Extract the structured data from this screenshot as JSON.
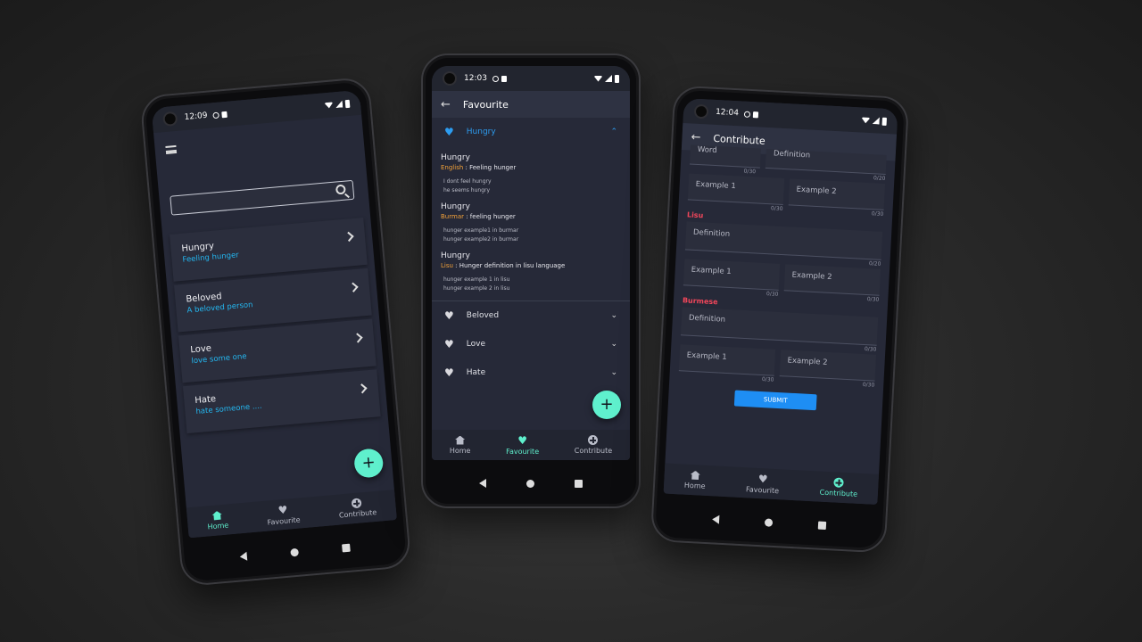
{
  "phone1": {
    "status_time": "12:09",
    "search": {
      "placeholder": ""
    },
    "words": [
      {
        "title": "Hungry",
        "subtitle": "Feeling hunger"
      },
      {
        "title": "Beloved",
        "subtitle": "A beloved person"
      },
      {
        "title": "Love",
        "subtitle": "love some one"
      },
      {
        "title": "Hate",
        "subtitle": "hate someone ...."
      }
    ],
    "fab_label": "+",
    "bottom_nav": [
      {
        "label": "Home",
        "icon": "home-icon",
        "active": true
      },
      {
        "label": "Favourite",
        "icon": "heart-icon",
        "active": false
      },
      {
        "label": "Contribute",
        "icon": "plus-circle-icon",
        "active": false
      }
    ]
  },
  "phone2": {
    "status_time": "12:03",
    "title": "Favourite",
    "open_item": {
      "label": "Hungry",
      "definitions": [
        {
          "word": "Hungry",
          "lang": "English",
          "definition": "Feeling hunger",
          "examples": [
            "I dont feel hungry",
            "he seems hungry"
          ]
        },
        {
          "word": "Hungry",
          "lang": "Burmar",
          "definition": "feeling hunger",
          "examples": [
            "hunger example1 in burmar",
            "hunger example2 in burmar"
          ]
        },
        {
          "word": "Hungry",
          "lang": "Lisu",
          "definition": "Hunger definition in lisu language",
          "examples": [
            "hunger example 1 in lisu",
            "hunger example 2 in lisu"
          ]
        }
      ]
    },
    "closed_items": [
      "Beloved",
      "Love",
      "Hate"
    ],
    "fab_label": "+",
    "bottom_nav": [
      {
        "label": "Home",
        "active": false
      },
      {
        "label": "Favourite",
        "active": true
      },
      {
        "label": "Contribute",
        "active": false
      }
    ]
  },
  "phone3": {
    "status_time": "12:04",
    "title": "Contribute",
    "top_fields": {
      "word": "Word",
      "definition": "Definition",
      "word_counter": "0/30",
      "definition_counter": "0/20"
    },
    "english_examples": {
      "ex1": "Example 1",
      "ex2": "Example 2",
      "c1": "0/30",
      "c2": "0/30"
    },
    "lisu": {
      "title": "Lisu",
      "definition": "Definition",
      "def_counter": "0/20",
      "ex1": "Example 1",
      "ex2": "Example 2",
      "c1": "0/30",
      "c2": "0/30"
    },
    "burmese": {
      "title": "Burmese",
      "definition": "Definition",
      "def_counter": "0/30",
      "ex1": "Example 1",
      "ex2": "Example 2",
      "c1": "0/30",
      "c2": "0/30"
    },
    "submit_label": "SUBMIT",
    "bottom_nav": [
      {
        "label": "Home",
        "active": false
      },
      {
        "label": "Favourite",
        "active": false
      },
      {
        "label": "Contribute",
        "active": true
      }
    ]
  },
  "colors": {
    "accent": "#5ff0cd",
    "link_blue": "#24b6ef",
    "heart_blue": "#2d9cf0",
    "lang_orange": "#f2a13a",
    "section_red": "#f0465a",
    "submit_blue": "#1e8ef4"
  }
}
